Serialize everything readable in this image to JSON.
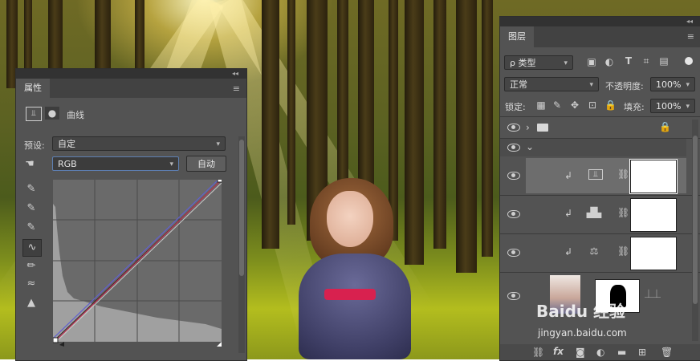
{
  "properties_panel": {
    "tab_label": "属性",
    "panel_title": "曲线",
    "preset_label": "预设:",
    "preset_value": "自定",
    "channel_value": "RGB",
    "auto_button": "自动"
  },
  "layers_panel": {
    "tab_label": "图层",
    "filter_kind": "ρ 类型",
    "blend_mode": "正常",
    "opacity_label": "不透明度:",
    "opacity_value": "100%",
    "lock_label": "锁定:",
    "fill_label": "填充:",
    "fill_value": "100%",
    "bottom_icons": [
      "link-icon",
      "fx-icon",
      "add-mask-icon",
      "adjustment-icon",
      "group-folder-icon",
      "new-layer-icon",
      "trash-icon"
    ]
  },
  "watermark": {
    "brand": "Baidu 经验",
    "url": "jingyan.baidu.com"
  },
  "colors": {
    "panel_bg": "#535353",
    "panel_dark": "#424242",
    "selected_row": "#6d6d6d",
    "sash": "#d8214f"
  }
}
